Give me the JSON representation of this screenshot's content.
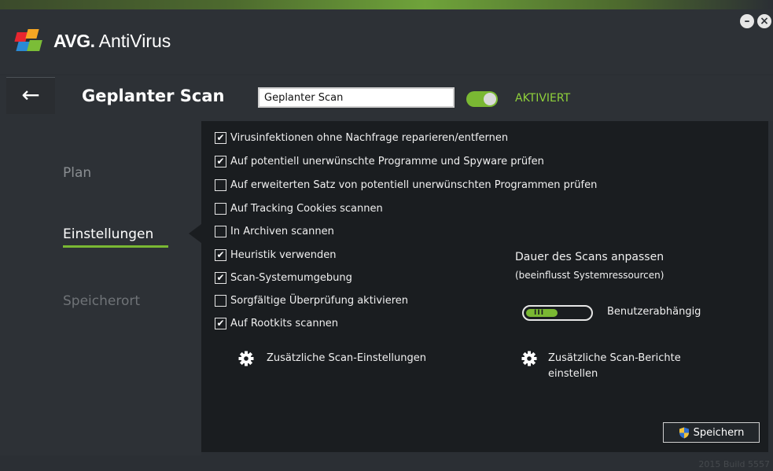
{
  "app": {
    "name_bold": "AVG.",
    "name_rest": " AntiVirus"
  },
  "window": {
    "minimize_glyph": "–",
    "close_glyph": "×"
  },
  "header": {
    "back_glyph": "←",
    "title": "Geplanter Scan",
    "name_input_value": "Geplanter Scan",
    "toggle_label": "AKTIVIERT",
    "toggle_on": true
  },
  "sidebar": {
    "items": [
      {
        "label": "Plan",
        "active": false
      },
      {
        "label": "Einstellungen",
        "active": true
      },
      {
        "label": "Speicherort",
        "active": false
      }
    ]
  },
  "options": [
    {
      "label": "Virusinfektionen ohne Nachfrage reparieren/entfernen",
      "checked": true
    },
    {
      "label": "Auf potentiell unerwünschte Programme und Spyware prüfen",
      "checked": true
    },
    {
      "label": "Auf erweiterten Satz von potentiell unerwünschten Programmen prüfen",
      "checked": false
    },
    {
      "label": "Auf Tracking Cookies scannen",
      "checked": false
    },
    {
      "label": "In Archiven scannen",
      "checked": false
    },
    {
      "label": "Heuristik verwenden",
      "checked": true
    },
    {
      "label": "Scan-Systemumgebung",
      "checked": true
    },
    {
      "label": "Sorgfältige Überprüfung aktivieren",
      "checked": false
    },
    {
      "label": "Auf Rootkits scannen",
      "checked": true
    }
  ],
  "links": {
    "additional_settings": "Zusätzliche Scan-Einstellungen",
    "additional_reports_line1": "Zusätzliche Scan-Berichte",
    "additional_reports_line2": "einstellen"
  },
  "duration": {
    "title": "Dauer des Scans anpassen",
    "subtitle": "(beeinflusst Systemressourcen)",
    "level_fraction": 0.5,
    "value_label": "Benutzerabhängig",
    "grip_glyph": "III"
  },
  "save_label": "Speichern",
  "build": "2015 Build 5557",
  "colors": {
    "accent": "#7ab833",
    "panel": "#1a1d20",
    "background": "#2d3136"
  },
  "icons": {
    "back": "arrow-left-icon",
    "gear": "gear-icon",
    "shield": "uac-shield-icon"
  }
}
